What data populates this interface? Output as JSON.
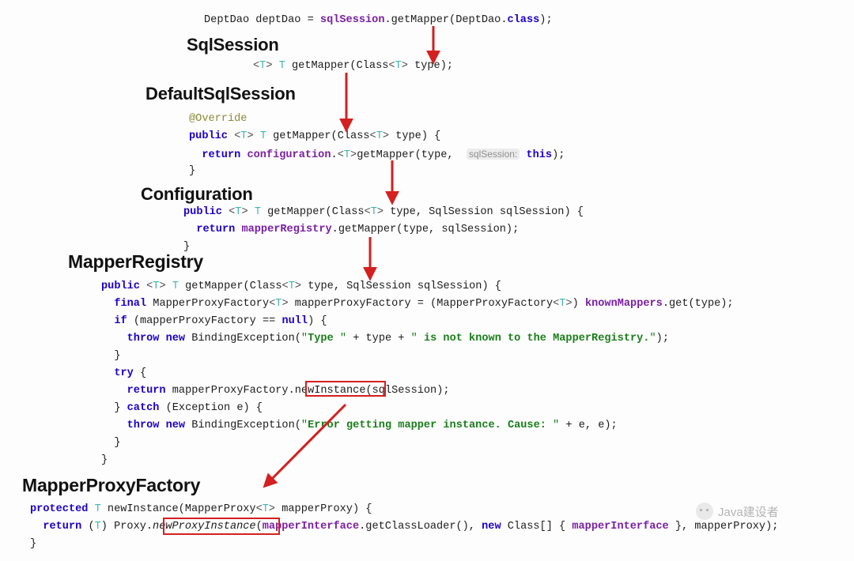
{
  "page": {
    "title": "MyBatis getMapper call chain",
    "background": "#fdfdfd",
    "accent_red": "#d42020"
  },
  "colors": {
    "keyword": "#1d00c8",
    "annotation": "#8b8b38",
    "generic": "#3fb8b0",
    "field": "#7b1fa2",
    "string": "#1a7f1a",
    "plain": "#1c1c1c",
    "arrow": "#d42020",
    "hint_bg": "#ececec",
    "hint_fg": "#8f8f8f"
  },
  "entry": {
    "line": "DeptDao deptDao = sqlSession.getMapper(DeptDao.class);",
    "tokens": {
      "type": "DeptDao",
      "var": "deptDao",
      "assign": "=",
      "receiver": "sqlSession",
      "method": ".getMapper(",
      "arg": "DeptDao.",
      "class_kw": "class",
      "tail": ");"
    }
  },
  "sections": [
    {
      "id": "sqlsession",
      "heading": "SqlSession",
      "lines": [
        "<T> T getMapper(Class<T> type);"
      ]
    },
    {
      "id": "defaultsqlsession",
      "heading": "DefaultSqlSession",
      "lines": [
        "@Override",
        "public <T> T getMapper(Class<T> type) {",
        "  return configuration.<T>getMapper(type,  sqlSession: this);",
        "}"
      ],
      "hint_label": "sqlSession:"
    },
    {
      "id": "configuration",
      "heading": "Configuration",
      "lines": [
        "public <T> T getMapper(Class<T> type, SqlSession sqlSession) {",
        "  return mapperRegistry.getMapper(type, sqlSession);",
        "}"
      ]
    },
    {
      "id": "mapperregistry",
      "heading": "MapperRegistry",
      "lines": [
        "public <T> T getMapper(Class<T> type, SqlSession sqlSession) {",
        "  final MapperProxyFactory<T> mapperProxyFactory = (MapperProxyFactory<T>) knownMappers.get(type);",
        "  if (mapperProxyFactory == null) {",
        "    throw new BindingException(\"Type \" + type + \" is not known to the MapperRegistry.\");",
        "  }",
        "  try {",
        "    return mapperProxyFactory.newInstance(sqlSession);",
        "  } catch (Exception e) {",
        "    throw new BindingException(\"Error getting mapper instance. Cause: \" + e, e);",
        "  }",
        "}"
      ],
      "strings": [
        "Type ",
        " is not known to the MapperRegistry.",
        "Error getting mapper instance. Cause: "
      ]
    },
    {
      "id": "mapperproxyfactory",
      "heading": "MapperProxyFactory",
      "lines": [
        "protected T newInstance(MapperProxy<T> mapperProxy) {",
        "  return (T) Proxy.newProxyInstance(mapperInterface.getClassLoader(), new Class[] { mapperInterface }, mapperProxy);",
        "}"
      ]
    }
  ],
  "highlights": [
    {
      "id": "newInstance-box",
      "label": "newInstance"
    },
    {
      "id": "newProxyInstance-box",
      "label": "newProxyInstance"
    }
  ],
  "arrows": [
    {
      "id": "arrow-1",
      "from": "entry-getMapper",
      "to": "sqlsession-getMapper"
    },
    {
      "id": "arrow-2",
      "from": "sqlsession-getMapper",
      "to": "defaultsqlsession-getMapper"
    },
    {
      "id": "arrow-3",
      "from": "defaultsqlsession-configuration",
      "to": "configuration-getMapper"
    },
    {
      "id": "arrow-4",
      "from": "configuration-mapperRegistry",
      "to": "mapperregistry-getMapper"
    },
    {
      "id": "arrow-5",
      "from": "newInstance-box",
      "to": "mapperproxyfactory-heading"
    }
  ],
  "watermark": {
    "text": "Java建设者",
    "logo": "wechat-avatar-icon"
  }
}
